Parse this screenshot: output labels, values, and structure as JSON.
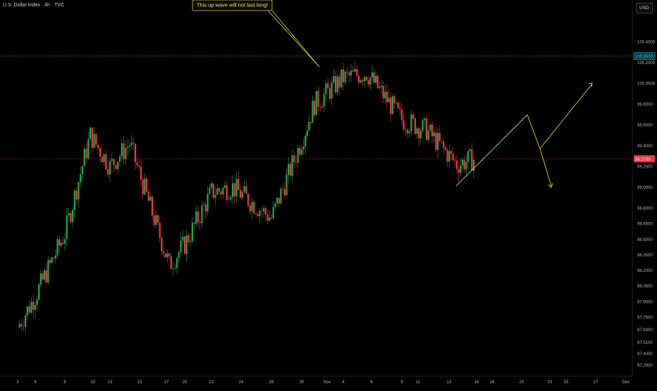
{
  "header": {
    "symbol_title": "U.S. Dollar Index · 4h · TVC",
    "currency_label": "USD"
  },
  "annotation": {
    "text": "This up wave will not last long!"
  },
  "chart_data": {
    "type": "candlestick",
    "title": "U.S. Dollar Index · 4h · TVC",
    "currency": "USD",
    "ylim": [
      97.18,
      100.53
    ],
    "price_ticks": [
      "100.4000",
      "100.2000",
      "100.0000",
      "99.8000",
      "99.6000",
      "99.4000",
      "99.2000",
      "99.0000",
      "98.8000",
      "98.6500",
      "98.5000",
      "98.3500",
      "98.2000",
      "98.0500",
      "97.9000",
      "97.7500",
      "97.6300",
      "97.5100",
      "97.4000",
      "97.2900"
    ],
    "price_tick_values": [
      100.4,
      100.2,
      100.0,
      99.8,
      99.6,
      99.4,
      99.2,
      99.0,
      98.8,
      98.65,
      98.5,
      98.35,
      98.2,
      98.05,
      97.9,
      97.75,
      97.63,
      97.51,
      97.4,
      97.29
    ],
    "date_labels": [
      "3",
      "6",
      "8",
      "10",
      "13",
      "15",
      "17",
      "20",
      "22",
      "24",
      "28",
      "30",
      "Nov",
      "4",
      "6",
      "9",
      "11",
      "13",
      "16",
      "18",
      "20",
      "23",
      "25",
      "27",
      "Dec"
    ],
    "grid": false,
    "last_price": {
      "label": "99.2730",
      "value": 99.273,
      "color": "#f23645"
    },
    "high_marker": {
      "label": "100.2610",
      "value": 100.261,
      "color": "#26a5c9"
    },
    "up_color": "#22ab4d",
    "down_color": "#f23645",
    "projection_color": "#d4d43a",
    "waypoints": [
      {
        "label": "3",
        "price": 97.65
      },
      {
        "label": "6",
        "price": 97.95
      },
      {
        "label": "8",
        "price": 98.55
      },
      {
        "label": "10",
        "price": 99.5
      },
      {
        "label": "13",
        "price": 99.2
      },
      {
        "label": "15",
        "price": 99.42
      },
      {
        "label": "17",
        "price": 98.25
      },
      {
        "label": "20",
        "price": 98.45
      },
      {
        "label": "22",
        "price": 98.95
      },
      {
        "label": "24",
        "price": 99.0
      },
      {
        "label": "28",
        "price": 98.7
      },
      {
        "label": "30",
        "price": 99.45
      },
      {
        "label": "Nov",
        "price": 99.8
      },
      {
        "label": "4",
        "price": 100.05
      },
      {
        "label": "6",
        "price": 100.1
      },
      {
        "label": "9",
        "price": 99.65
      },
      {
        "label": "11",
        "price": 99.55
      },
      {
        "label": "13",
        "price": 99.22
      },
      {
        "label": "16",
        "price": 99.27
      }
    ]
  }
}
